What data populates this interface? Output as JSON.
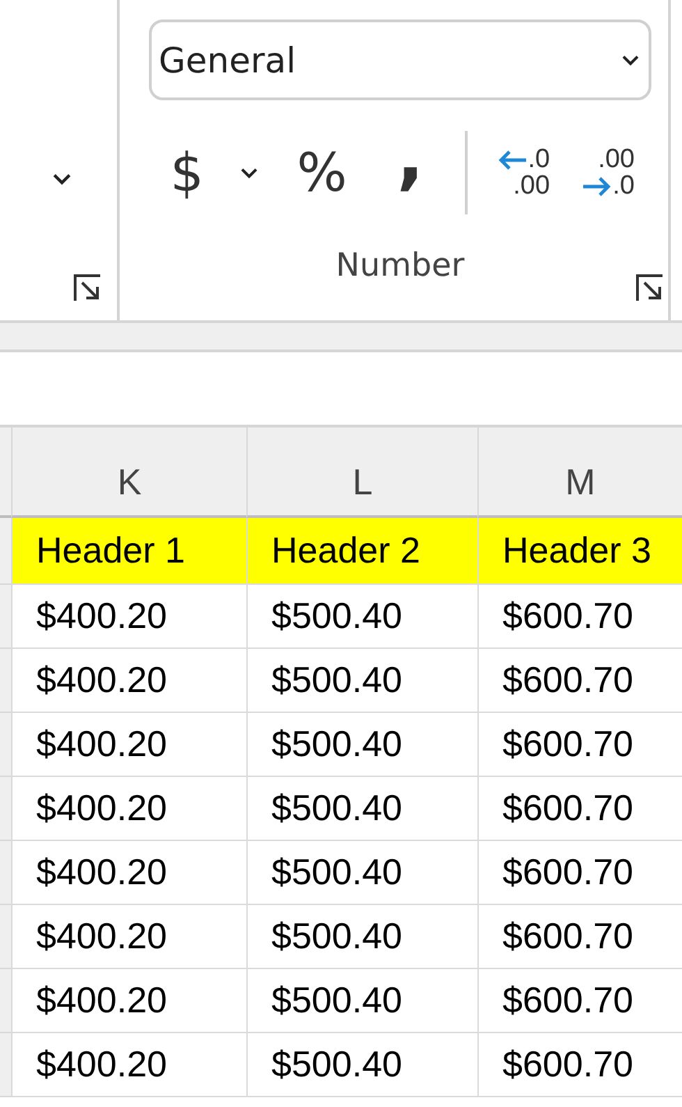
{
  "ribbon": {
    "number_group": {
      "format_dropdown": {
        "value": "General"
      },
      "buttons": [
        {
          "kind": "currency",
          "label": "$"
        },
        {
          "kind": "percent",
          "label": "%"
        },
        {
          "kind": "comma",
          "label": ","
        },
        {
          "kind": "decrease_decimal",
          "top": ".0",
          "bottom": ".00"
        },
        {
          "kind": "increase_decimal",
          "top": ".00",
          "bottom": ".0"
        }
      ],
      "label": "Number"
    }
  },
  "sheet": {
    "columns": [
      "K",
      "L",
      "M"
    ],
    "header_row": [
      "Header 1",
      "Header 2",
      "Header 3"
    ],
    "rows": [
      [
        "$400.20",
        "$500.40",
        "$600.70"
      ],
      [
        "$400.20",
        "$500.40",
        "$600.70"
      ],
      [
        "$400.20",
        "$500.40",
        "$600.70"
      ],
      [
        "$400.20",
        "$500.40",
        "$600.70"
      ],
      [
        "$400.20",
        "$500.40",
        "$600.70"
      ],
      [
        "$400.20",
        "$500.40",
        "$600.70"
      ],
      [
        "$400.20",
        "$500.40",
        "$600.70"
      ],
      [
        "$400.20",
        "$500.40",
        "$600.70"
      ]
    ]
  }
}
